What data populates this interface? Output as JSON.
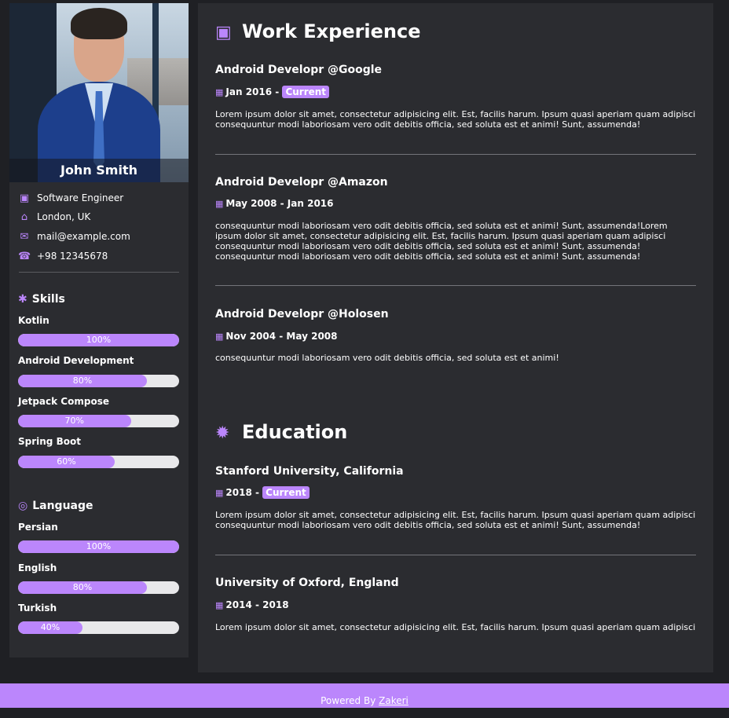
{
  "profile": {
    "name": "John Smith",
    "title": "Software Engineer",
    "location": "London, UK",
    "email": "mail@example.com",
    "phone": "+98 12345678"
  },
  "skills": {
    "heading": "Skills",
    "items": [
      {
        "name": "Kotlin",
        "level": 100,
        "label": "100%"
      },
      {
        "name": "Android Development",
        "level": 80,
        "label": "80%"
      },
      {
        "name": "Jetpack Compose",
        "level": 70,
        "label": "70%"
      },
      {
        "name": "Spring Boot",
        "level": 60,
        "label": "60%"
      }
    ]
  },
  "languages": {
    "heading": "Language",
    "items": [
      {
        "name": "Persian",
        "level": 100,
        "label": "100%"
      },
      {
        "name": "English",
        "level": 80,
        "label": "80%"
      },
      {
        "name": "Turkish",
        "level": 40,
        "label": "40%"
      }
    ]
  },
  "work": {
    "heading": "Work Experience",
    "jobs": [
      {
        "title": "Android Developr @Google",
        "date": "Jan 2016 -",
        "badge": "Current",
        "desc": "Lorem ipsum dolor sit amet, consectetur adipisicing elit. Est, facilis harum. Ipsum quasi aperiam quam adipisci consequuntur modi laboriosam vero odit debitis officia, sed soluta est et animi! Sunt, assumenda!"
      },
      {
        "title": "Android Developr @Amazon",
        "date": "May 2008 - Jan 2016",
        "badge": "",
        "desc": "consequuntur modi laboriosam vero odit debitis officia, sed soluta est et animi! Sunt, assumenda!Lorem ipsum dolor sit amet, consectetur adipisicing elit. Est, facilis harum. Ipsum quasi aperiam quam adipisci consequuntur modi laboriosam vero odit debitis officia, sed soluta est et animi! Sunt, assumenda! consequuntur modi laboriosam vero odit debitis officia, sed soluta est et animi! Sunt, assumenda!"
      },
      {
        "title": "Android Developr @Holosen",
        "date": "Nov 2004 - May 2008",
        "badge": "",
        "desc": "consequuntur modi laboriosam vero odit debitis officia, sed soluta est et animi!"
      }
    ]
  },
  "education": {
    "heading": "Education",
    "items": [
      {
        "title": "Stanford University, California",
        "date": "2018 -",
        "badge": "Current",
        "desc": "Lorem ipsum dolor sit amet, consectetur adipisicing elit. Est, facilis harum. Ipsum quasi aperiam quam adipisci consequuntur modi laboriosam vero odit debitis officia, sed soluta est et animi! Sunt, assumenda!"
      },
      {
        "title": "University of Oxford, England",
        "date": "2014 - 2018",
        "badge": "",
        "desc": "Lorem ipsum dolor sit amet, consectetur adipisicing elit. Est, facilis harum. Ipsum quasi aperiam quam adipisci"
      }
    ]
  },
  "footer": {
    "prefix": "Powered By",
    "link": "Zakeri"
  },
  "colors": {
    "accent": "#bb86fc",
    "panel": "#2b2c30",
    "background": "#1f2024"
  },
  "icons": {
    "title": "briefcase-icon",
    "location": "home-icon",
    "email": "envelope-icon",
    "phone": "phone-icon",
    "skills": "asterisk-icon",
    "language": "globe-icon",
    "work": "briefcase-icon",
    "education": "certificate-icon",
    "date": "calendar-icon"
  }
}
